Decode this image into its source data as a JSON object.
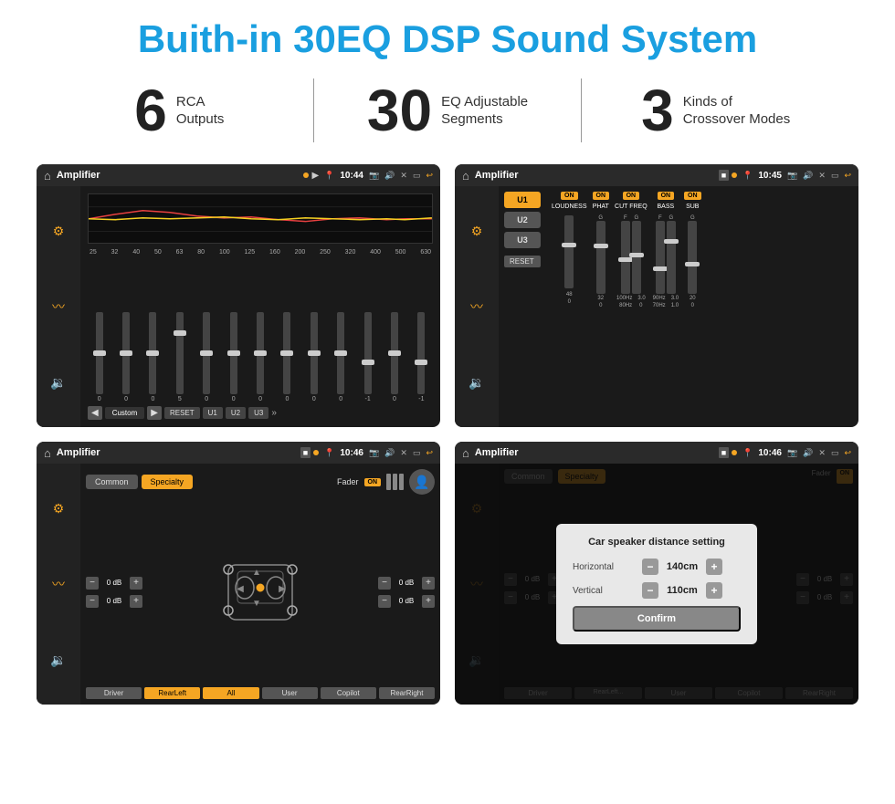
{
  "page": {
    "title": "Buith-in 30EQ DSP Sound System",
    "background": "#ffffff"
  },
  "stats": [
    {
      "number": "6",
      "label": "RCA\nOutputs"
    },
    {
      "number": "30",
      "label": "EQ Adjustable\nSegments"
    },
    {
      "number": "3",
      "label": "Kinds of\nCrossover Modes"
    }
  ],
  "screens": {
    "screen1": {
      "title": "Amplifier",
      "time": "10:44",
      "freq_labels": [
        "25",
        "32",
        "40",
        "50",
        "63",
        "80",
        "100",
        "125",
        "160",
        "200",
        "250",
        "320",
        "400",
        "500",
        "630"
      ],
      "eq_values": [
        "0",
        "0",
        "0",
        "5",
        "0",
        "0",
        "0",
        "0",
        "0",
        "0",
        "-1",
        "0",
        "-1"
      ],
      "preset": "Custom",
      "buttons": [
        "RESET",
        "U1",
        "U2",
        "U3"
      ]
    },
    "screen2": {
      "title": "Amplifier",
      "time": "10:45",
      "presets": [
        "U1",
        "U2",
        "U3"
      ],
      "controls": [
        "LOUDNESS",
        "PHAT",
        "CUT FREQ",
        "BASS",
        "SUB"
      ],
      "reset_label": "RESET"
    },
    "screen3": {
      "title": "Amplifier",
      "time": "10:46",
      "tabs": [
        "Common",
        "Specialty"
      ],
      "fader_label": "Fader",
      "fader_on": "ON",
      "channels": {
        "left_top": "0 dB",
        "left_bottom": "0 dB",
        "right_top": "0 dB",
        "right_bottom": "0 dB"
      },
      "buttons": [
        "Driver",
        "RearLeft",
        "All",
        "User",
        "Copilot",
        "RearRight"
      ]
    },
    "screen4": {
      "title": "Amplifier",
      "time": "10:46",
      "dialog": {
        "title": "Car speaker distance setting",
        "horizontal_label": "Horizontal",
        "horizontal_value": "140cm",
        "vertical_label": "Vertical",
        "vertical_value": "110cm",
        "confirm_label": "Confirm",
        "right_db_top": "0 dB",
        "right_db_bottom": "0 dB",
        "bottom_buttons": [
          "RearLeft...",
          "Driver",
          "User",
          "Copilot",
          "RearRight"
        ]
      }
    }
  }
}
